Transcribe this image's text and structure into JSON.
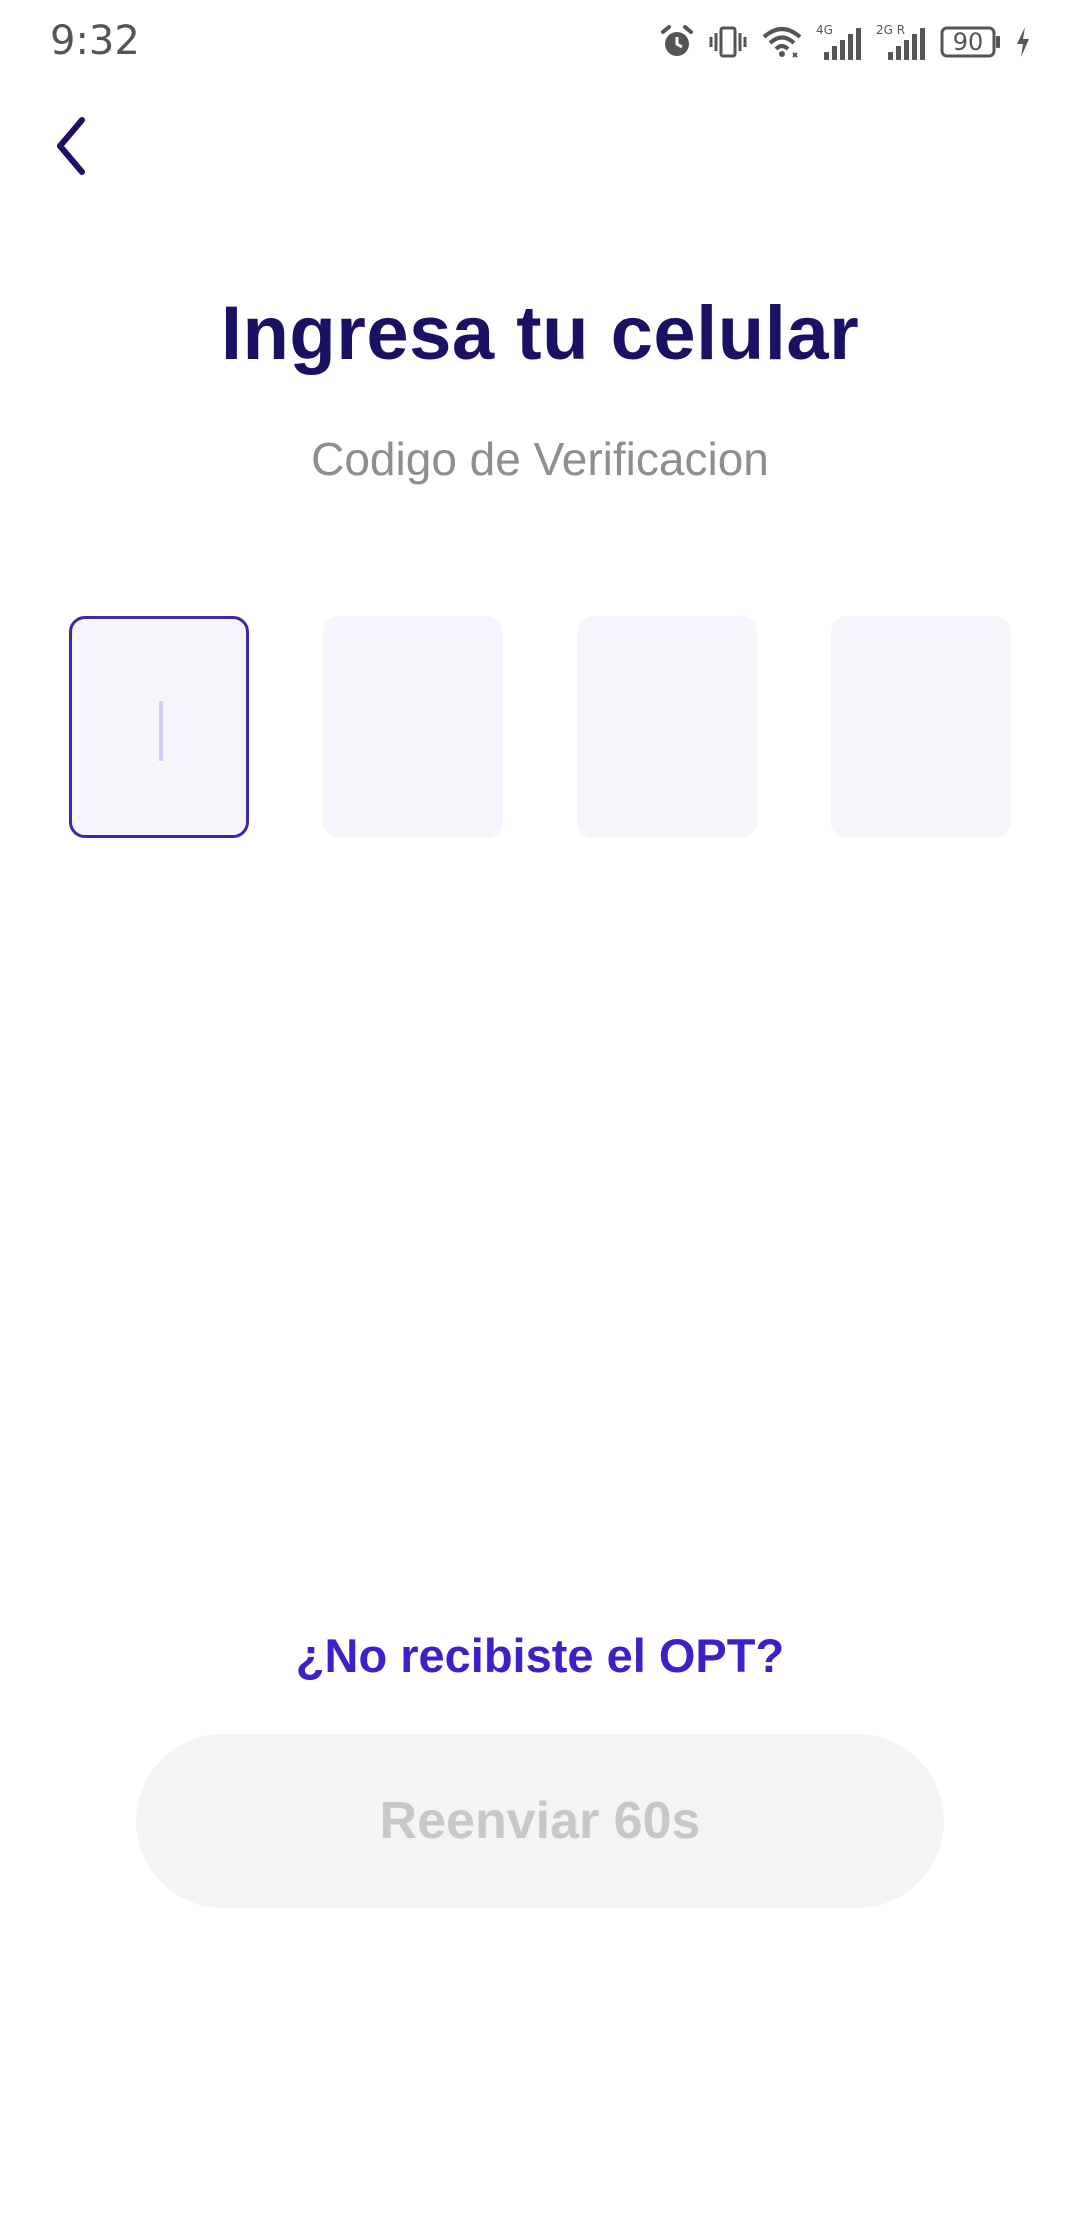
{
  "status_bar": {
    "time": "9:32",
    "battery_level": "90",
    "network_1": "4G",
    "network_2": "2G R",
    "icons": [
      "alarm-icon",
      "vibrate-icon",
      "wifi-icon",
      "signal-4g-icon",
      "signal-2g-icon",
      "battery-icon",
      "charging-icon"
    ]
  },
  "nav": {
    "back_icon": "chevron-left-icon"
  },
  "header": {
    "title": "Ingresa tu celular",
    "subtitle": "Codigo de Verificacion"
  },
  "otp": {
    "digits": [
      "",
      "",
      "",
      ""
    ],
    "active_index": 0
  },
  "resend": {
    "question": "¿No recibiste el OPT?",
    "button_label": "Reenviar 60s"
  },
  "colors": {
    "title": "#1a1164",
    "accent": "#3b22c8",
    "active_border": "#3b2aa8",
    "box_bg": "#f6f5fc",
    "disabled_bg": "#f4f4f4",
    "disabled_text": "#c8c8c8"
  }
}
